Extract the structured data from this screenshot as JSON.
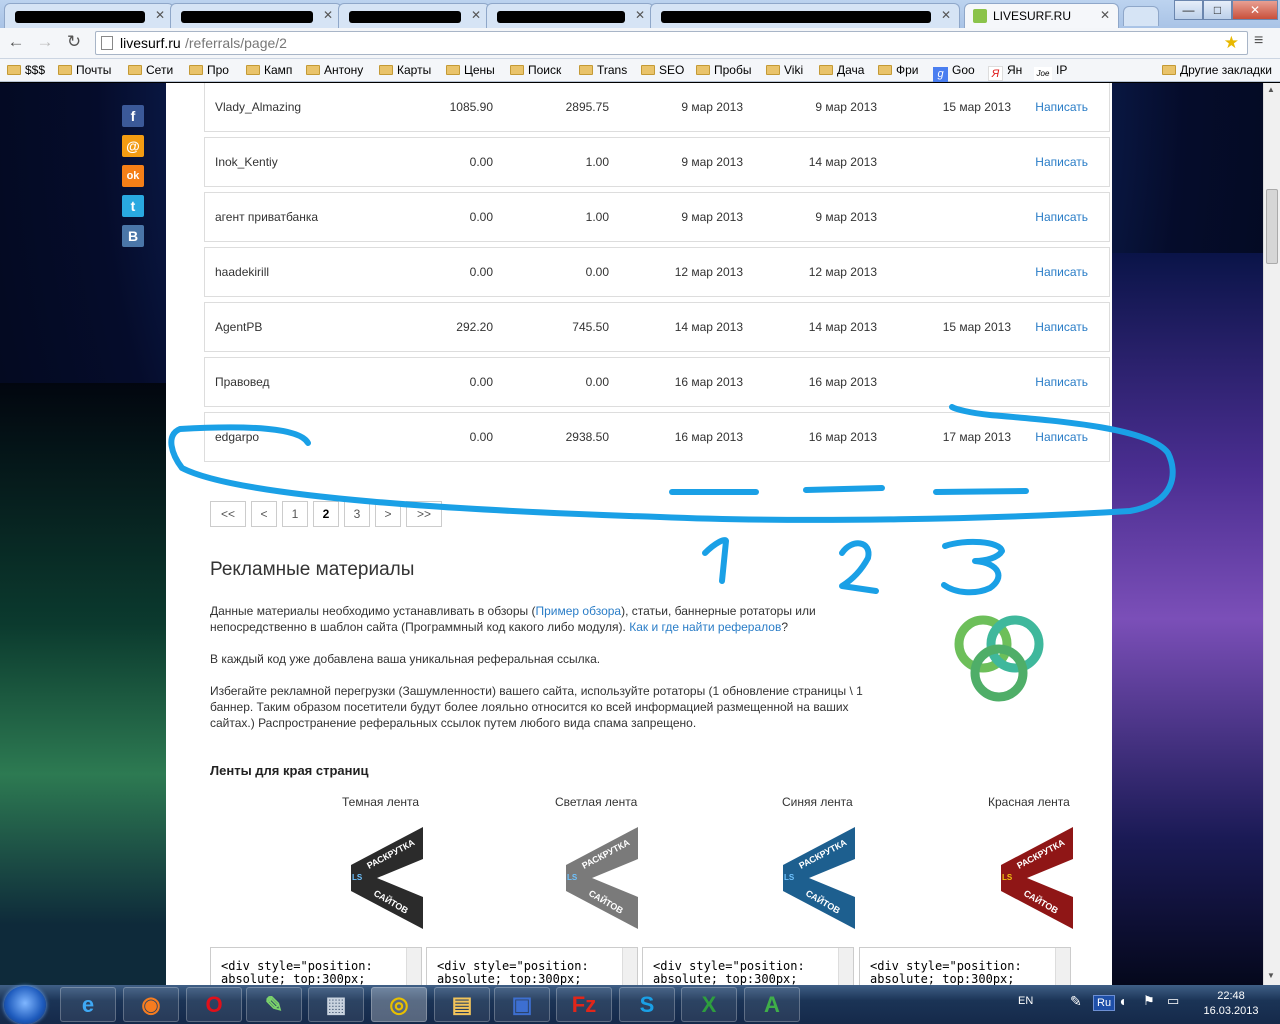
{
  "browser": {
    "tabs": [
      {
        "label": ""
      },
      {
        "label": ""
      },
      {
        "label": ""
      },
      {
        "label": ""
      },
      {
        "label": ""
      },
      {
        "label": "LIVESURF.RU"
      }
    ],
    "url_host": "livesurf.ru",
    "url_path": "/referrals/page/2",
    "window_controls": {
      "minimize": "—",
      "maximize": "□",
      "close": "✕"
    }
  },
  "bookmarks": [
    "$$$",
    "Почты",
    "Сети",
    "Про",
    "Камп",
    "Антону",
    "Карты",
    "Цены",
    "Поиск",
    "Trans",
    "SEO",
    "Пробы",
    "Viki",
    "Дача",
    "Фри",
    "Goo",
    "Ян",
    "IP"
  ],
  "bookmarks_other": "Другие закладки",
  "social_icons": [
    {
      "icon": "facebook-icon",
      "glyph": "f",
      "color": "#3b5998"
    },
    {
      "icon": "mail-ru-icon",
      "glyph": "@",
      "color": "#f39c12"
    },
    {
      "icon": "odnoklassniki-icon",
      "glyph": "ok",
      "color": "#f57f17"
    },
    {
      "icon": "twitter-icon",
      "glyph": "t",
      "color": "#29a9e0"
    },
    {
      "icon": "vkontakte-icon",
      "glyph": "B",
      "color": "#4a76a8"
    }
  ],
  "referrals": [
    {
      "name": "Vlady_Almazing",
      "v1": "1085.90",
      "v2": "2895.75",
      "d1": "9 мар 2013",
      "d2": "9 мар 2013",
      "d3": "15 мар 2013",
      "action": "Написать"
    },
    {
      "name": "Inok_Kentiy",
      "v1": "0.00",
      "v2": "1.00",
      "d1": "9 мар 2013",
      "d2": "14 мар 2013",
      "d3": "",
      "action": "Написать"
    },
    {
      "name": "агент приватбанка",
      "v1": "0.00",
      "v2": "1.00",
      "d1": "9 мар 2013",
      "d2": "9 мар 2013",
      "d3": "",
      "action": "Написать"
    },
    {
      "name": "haadekirill",
      "v1": "0.00",
      "v2": "0.00",
      "d1": "12 мар 2013",
      "d2": "12 мар 2013",
      "d3": "",
      "action": "Написать"
    },
    {
      "name": "AgentPB",
      "v1": "292.20",
      "v2": "745.50",
      "d1": "14 мар 2013",
      "d2": "14 мар 2013",
      "d3": "15 мар 2013",
      "action": "Написать"
    },
    {
      "name": "Правовед",
      "v1": "0.00",
      "v2": "0.00",
      "d1": "16 мар 2013",
      "d2": "16 мар 2013",
      "d3": "",
      "action": "Написать"
    },
    {
      "name": "edgarpo",
      "v1": "0.00",
      "v2": "2938.50",
      "d1": "16 мар 2013",
      "d2": "16 мар 2013",
      "d3": "17 мар 2013",
      "action": "Написать"
    }
  ],
  "pagination": {
    "first": "<<",
    "prev": "<",
    "pages": [
      "1",
      "2",
      "3"
    ],
    "current": "2",
    "next": ">",
    "last": ">>"
  },
  "promo": {
    "title": "Рекламные материалы",
    "p1_a": "Данные материалы необходимо устанавливать в обзоры (",
    "p1_link1": "Пример обзора",
    "p1_b": "), статьи, баннерные ротаторы или непосредственно в шаблон сайта (Программный код какого либо модуля). ",
    "p1_link2": "Как и где найти рефералов",
    "p1_c": "?",
    "p2": "В каждый код уже добавлена ваша уникальная реферальная ссылка.",
    "p3": "Избегайте рекламной перегрузки (Зашумленности) вашего сайта, используйте ротаторы (1 обновление страницы \\ 1 баннер. Таким образом посетители будут более лояльно относится ко всей информацией размещенной на ваших сайтах.) Распространение реферальных ссылок путем любого вида спама запрещено."
  },
  "ribbons": {
    "title": "Ленты для края страниц",
    "items": [
      {
        "label": "Темная лента",
        "color": "#2b2b2b",
        "code": "<div style=\"position:\nabsolute; top:300px;"
      },
      {
        "label": "Светлая лента",
        "color": "#7a7a7a",
        "code": "<div style=\"position:\nabsolute; top:300px;"
      },
      {
        "label": "Синяя лента",
        "color": "#1d5f8f",
        "code": "<div style=\"position:\nabsolute; top:300px;"
      },
      {
        "label": "Красная лента",
        "color": "#8f1616",
        "code": "<div style=\"position:\nabsolute; top:300px;"
      }
    ],
    "ribbon_text_top": "РАСКРУТКА",
    "ribbon_text_bottom": "САЙТОВ",
    "ribbon_badge": "LS"
  },
  "annotation": {
    "color": "#1aa0e6",
    "numbers": [
      "1",
      "2",
      "3"
    ]
  },
  "taskbar": {
    "apps": [
      {
        "icon": "internet-explorer-icon",
        "glyph": "e",
        "color": "#3fa9f5"
      },
      {
        "icon": "firefox-icon",
        "glyph": "◉",
        "color": "#f57c20"
      },
      {
        "icon": "opera-icon",
        "glyph": "O",
        "color": "#e0101a"
      },
      {
        "icon": "notepad-icon",
        "glyph": "✎",
        "color": "#7bd36b"
      },
      {
        "icon": "calculator-icon",
        "glyph": "▦",
        "color": "#c9d3df"
      },
      {
        "icon": "chrome-icon",
        "glyph": "◎",
        "color": "#e8c000"
      },
      {
        "icon": "explorer-folder-icon",
        "glyph": "▤",
        "color": "#f2c45a"
      },
      {
        "icon": "save-disk-icon",
        "glyph": "▣",
        "color": "#3d6fd1"
      },
      {
        "icon": "filezilla-icon",
        "glyph": "Fz",
        "color": "#e0261a"
      },
      {
        "icon": "skype-icon",
        "glyph": "S",
        "color": "#1aa0e6"
      },
      {
        "icon": "excel-icon",
        "glyph": "X",
        "color": "#2e9e3e"
      },
      {
        "icon": "anydesk-icon",
        "glyph": "A",
        "color": "#3fae49"
      }
    ],
    "lang": "EN",
    "kb_layout": "Ru",
    "time": "22:48",
    "date": "16.03.2013"
  }
}
